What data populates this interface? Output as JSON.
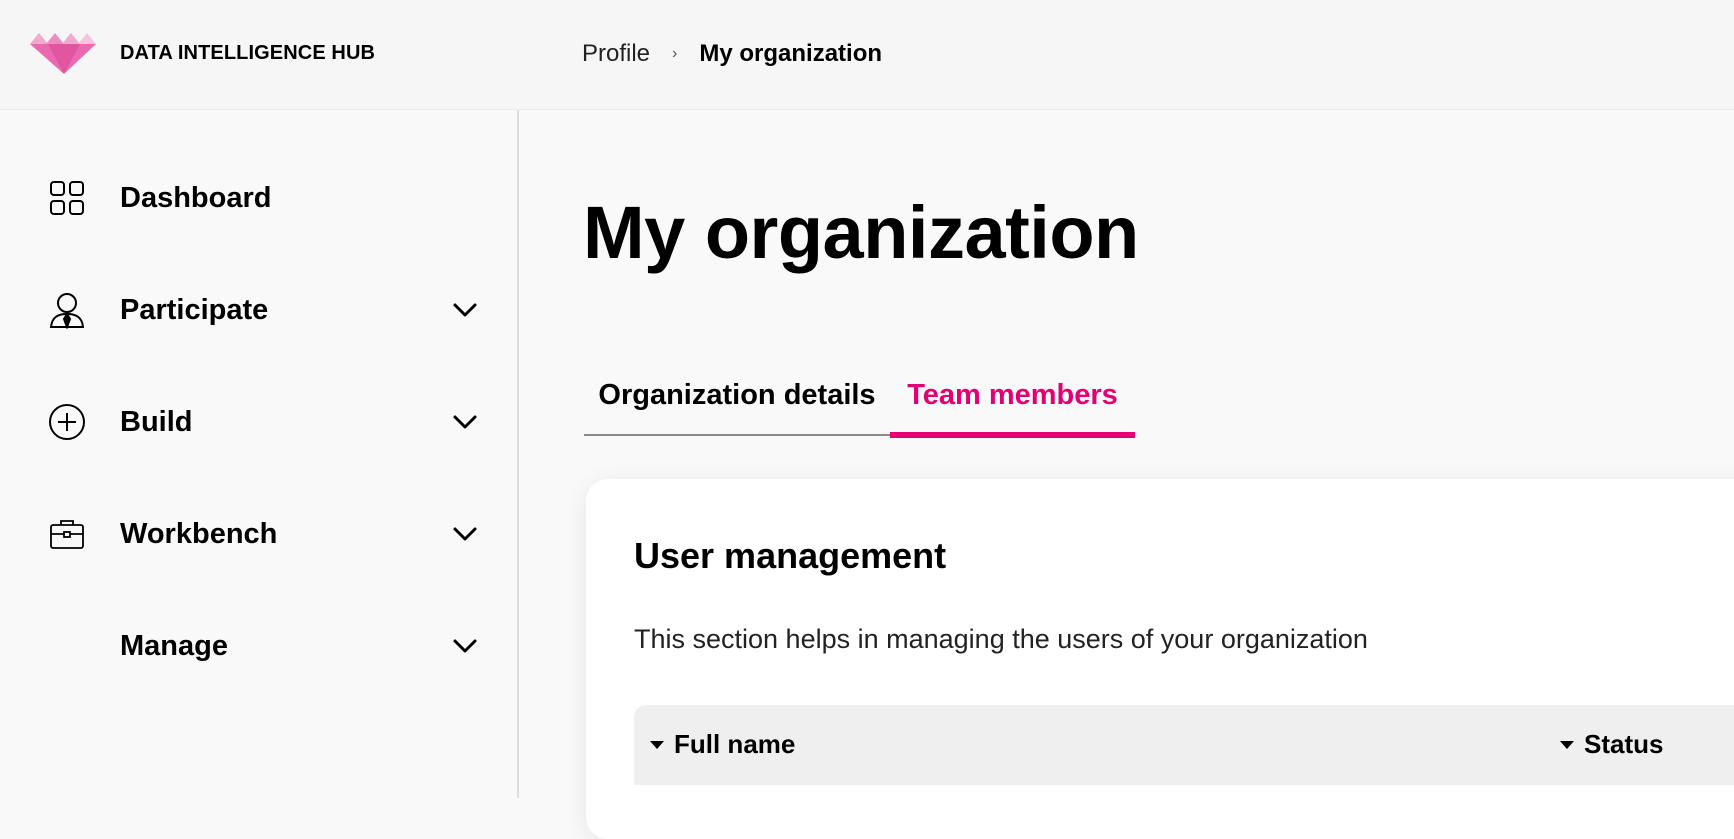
{
  "header": {
    "brand": "DATA INTELLIGENCE HUB",
    "breadcrumb": {
      "parent": "Profile",
      "separator": "›",
      "current": "My organization"
    }
  },
  "sidebar": {
    "items": [
      {
        "label": "Dashboard",
        "icon": "dashboard-grid-icon"
      },
      {
        "label": "Participate",
        "icon": "person-icon"
      },
      {
        "label": "Build",
        "icon": "plus-circle-icon"
      },
      {
        "label": "Workbench",
        "icon": "briefcase-icon"
      },
      {
        "label": "Manage",
        "icon": ""
      }
    ]
  },
  "main": {
    "title": "My organization",
    "tabs": [
      {
        "label": "Organization details"
      },
      {
        "label": "Team members"
      }
    ],
    "card": {
      "title": "User management",
      "description": "This section helps in managing the users of your organization",
      "columns": [
        "Full name",
        "Status"
      ]
    }
  },
  "colors": {
    "accent": "#e20074",
    "background": "#f9f9f9",
    "card": "#ffffff"
  }
}
